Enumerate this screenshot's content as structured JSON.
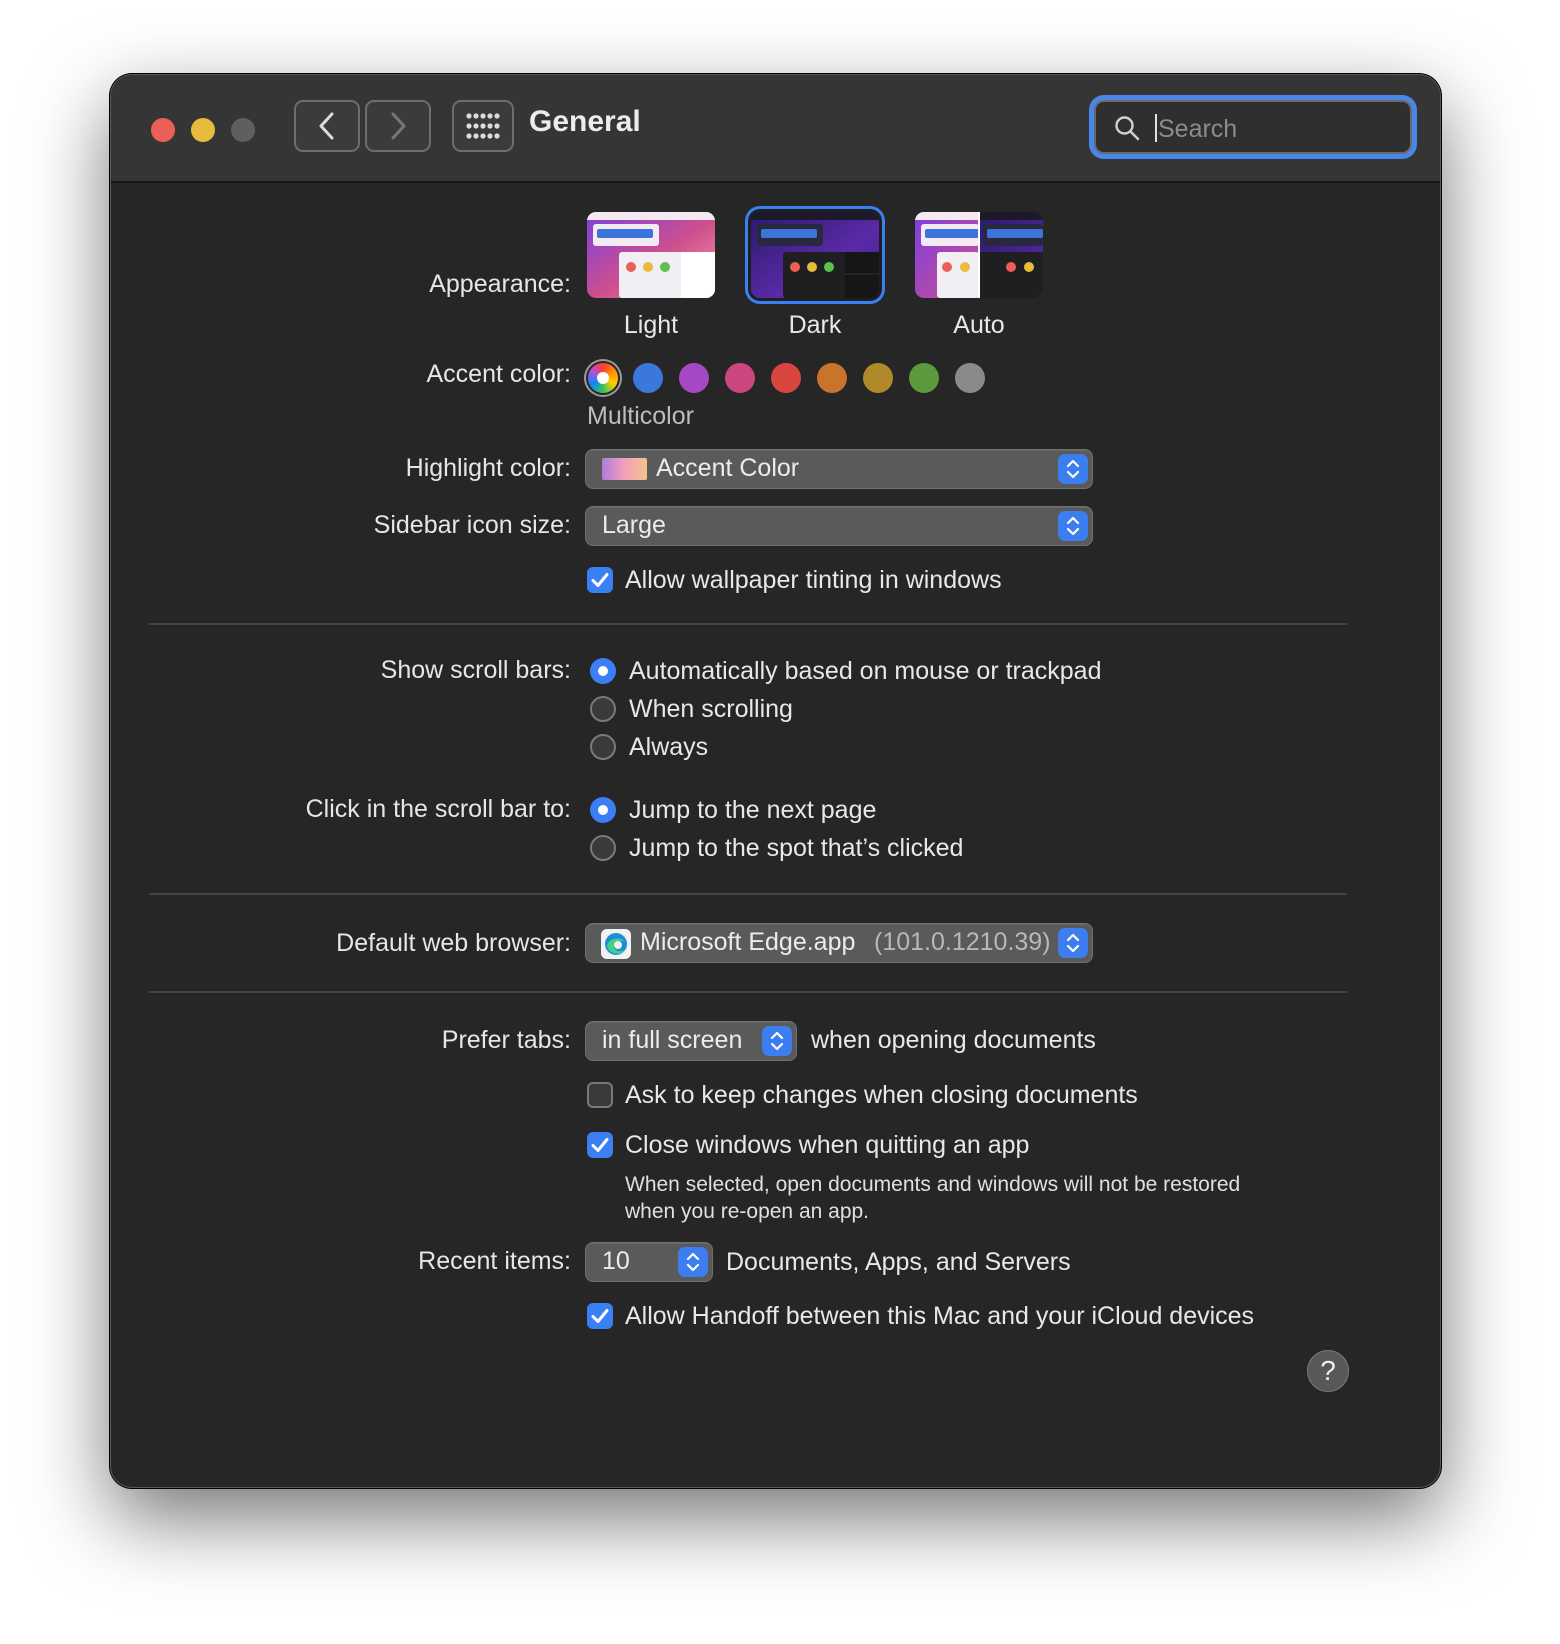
{
  "window": {
    "title": "General",
    "search": {
      "placeholder": "Search",
      "value": ""
    }
  },
  "appearance": {
    "label": "Appearance:",
    "options": [
      {
        "name": "Light",
        "selected": false
      },
      {
        "name": "Dark",
        "selected": true
      },
      {
        "name": "Auto",
        "selected": false
      }
    ]
  },
  "accent": {
    "label": "Accent color:",
    "selected_name": "Multicolor",
    "colors": [
      "multicolor",
      "#3a79d9",
      "#a548c4",
      "#cc4780",
      "#d9453f",
      "#c8742a",
      "#b08a2a",
      "#5c9a3e",
      "#8a8a8a"
    ]
  },
  "highlight": {
    "label": "Highlight color:",
    "value": "Accent Color"
  },
  "sidebar_icon_size": {
    "label": "Sidebar icon size:",
    "value": "Large"
  },
  "wallpaper_tinting": {
    "label": "Allow wallpaper tinting in windows",
    "checked": true
  },
  "scroll_bars": {
    "label": "Show scroll bars:",
    "options": [
      "Automatically based on mouse or trackpad",
      "When scrolling",
      "Always"
    ],
    "selected": 0
  },
  "click_scroll": {
    "label": "Click in the scroll bar to:",
    "options": [
      "Jump to the next page",
      "Jump to the spot that’s clicked"
    ],
    "selected": 0
  },
  "browser": {
    "label": "Default web browser:",
    "app": "Microsoft Edge.app",
    "version": "(101.0.1210.39)"
  },
  "prefer_tabs": {
    "label": "Prefer tabs:",
    "value": "in full screen",
    "suffix": "when opening documents"
  },
  "ask_keep_changes": {
    "label": "Ask to keep changes when closing documents",
    "checked": false
  },
  "close_windows": {
    "label": "Close windows when quitting an app",
    "checked": true,
    "note_line1": "When selected, open documents and windows will not be restored",
    "note_line2": "when you re-open an app."
  },
  "recent_items": {
    "label": "Recent items:",
    "value": "10",
    "suffix": "Documents, Apps, and Servers"
  },
  "handoff": {
    "label": "Allow Handoff between this Mac and your iCloud devices",
    "checked": true
  },
  "help": {
    "label": "?"
  }
}
